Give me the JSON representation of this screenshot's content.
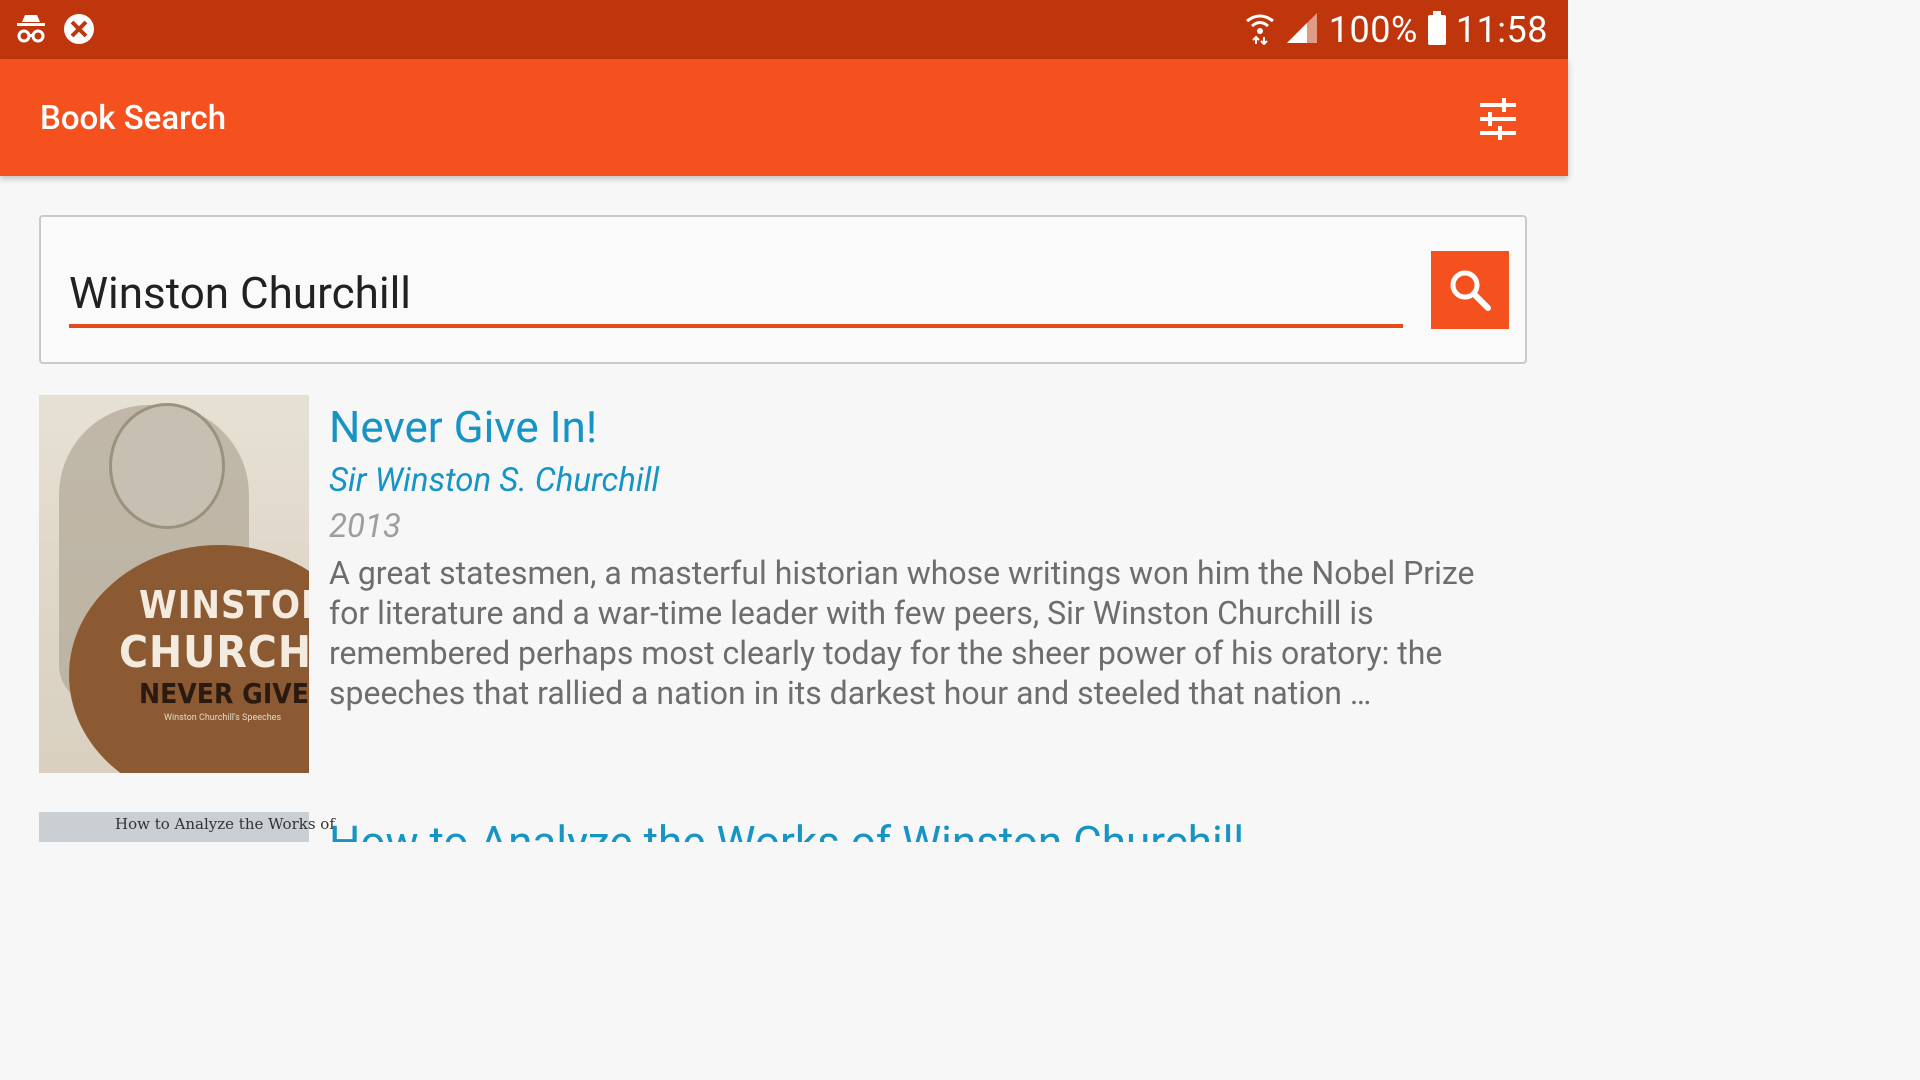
{
  "status_bar": {
    "battery": "100%",
    "time": "11:58"
  },
  "app_bar": {
    "title": "Book Search"
  },
  "search": {
    "query": "Winston Churchill"
  },
  "results": [
    {
      "title": "Never Give In!",
      "author": "Sir Winston S. Churchill",
      "year": "2013",
      "description": "A great statesmen, a masterful historian whose writings won him the Nobel Prize for literature and a war-time leader with few peers, Sir Winston Churchill is remembered perhaps most clearly today for the sheer power of his oratory: the speeches that rallied a nation in its darkest hour and steeled that nation …",
      "cover": {
        "line1": "WINSTON S.",
        "line2": "CHURCHILL",
        "line3": "NEVER GIVE IN!",
        "line4": "Winston Churchill's Speeches"
      }
    },
    {
      "title": "How to Analyze the Works of Winston Churchill",
      "cover": {
        "line1": "How to Analyze the Works of"
      }
    }
  ],
  "colors": {
    "status_bar": "#bf360c",
    "app_bar": "#f4511e",
    "accent": "#1594c5"
  }
}
